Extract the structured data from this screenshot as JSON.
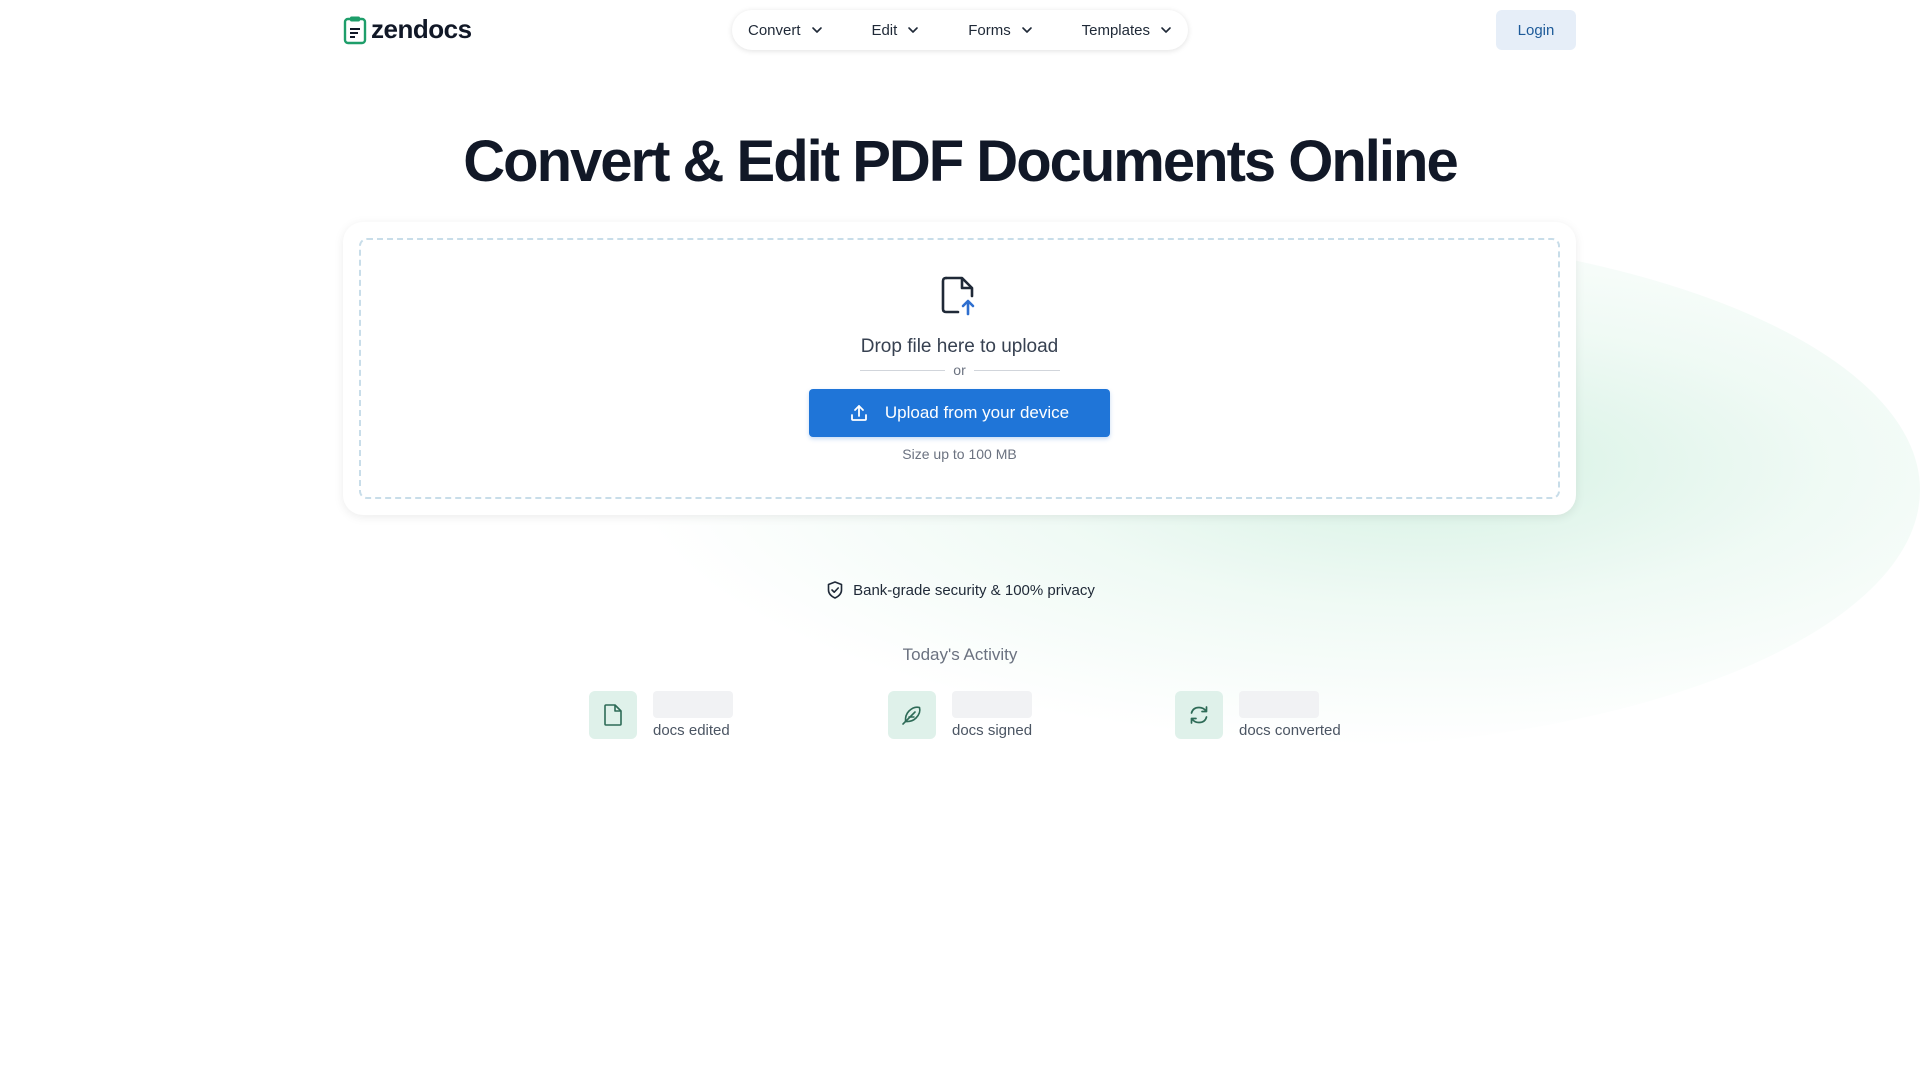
{
  "header": {
    "logo_text": "zendocs",
    "nav": [
      {
        "label": "Convert"
      },
      {
        "label": "Edit"
      },
      {
        "label": "Forms"
      },
      {
        "label": "Templates"
      }
    ],
    "login_label": "Login"
  },
  "hero": {
    "title": "Convert & Edit PDF Documents Online"
  },
  "upload": {
    "drop_text": "Drop file here to upload",
    "or_text": "or",
    "button_label": "Upload from your device",
    "size_text": "Size up to 100 MB"
  },
  "security": {
    "text": "Bank-grade security & 100% privacy"
  },
  "activity": {
    "title": "Today's Activity",
    "stats": [
      {
        "label": "docs edited",
        "icon": "document-icon"
      },
      {
        "label": "docs signed",
        "icon": "feather-icon"
      },
      {
        "label": "docs converted",
        "icon": "refresh-icon"
      }
    ]
  },
  "colors": {
    "brand_green": "#1e9e6a",
    "primary_blue": "#1f75d8",
    "login_bg": "#e6eef8",
    "login_text": "#1d5a99",
    "stat_icon_bg": "#dff1ea",
    "title_text": "#111827"
  }
}
